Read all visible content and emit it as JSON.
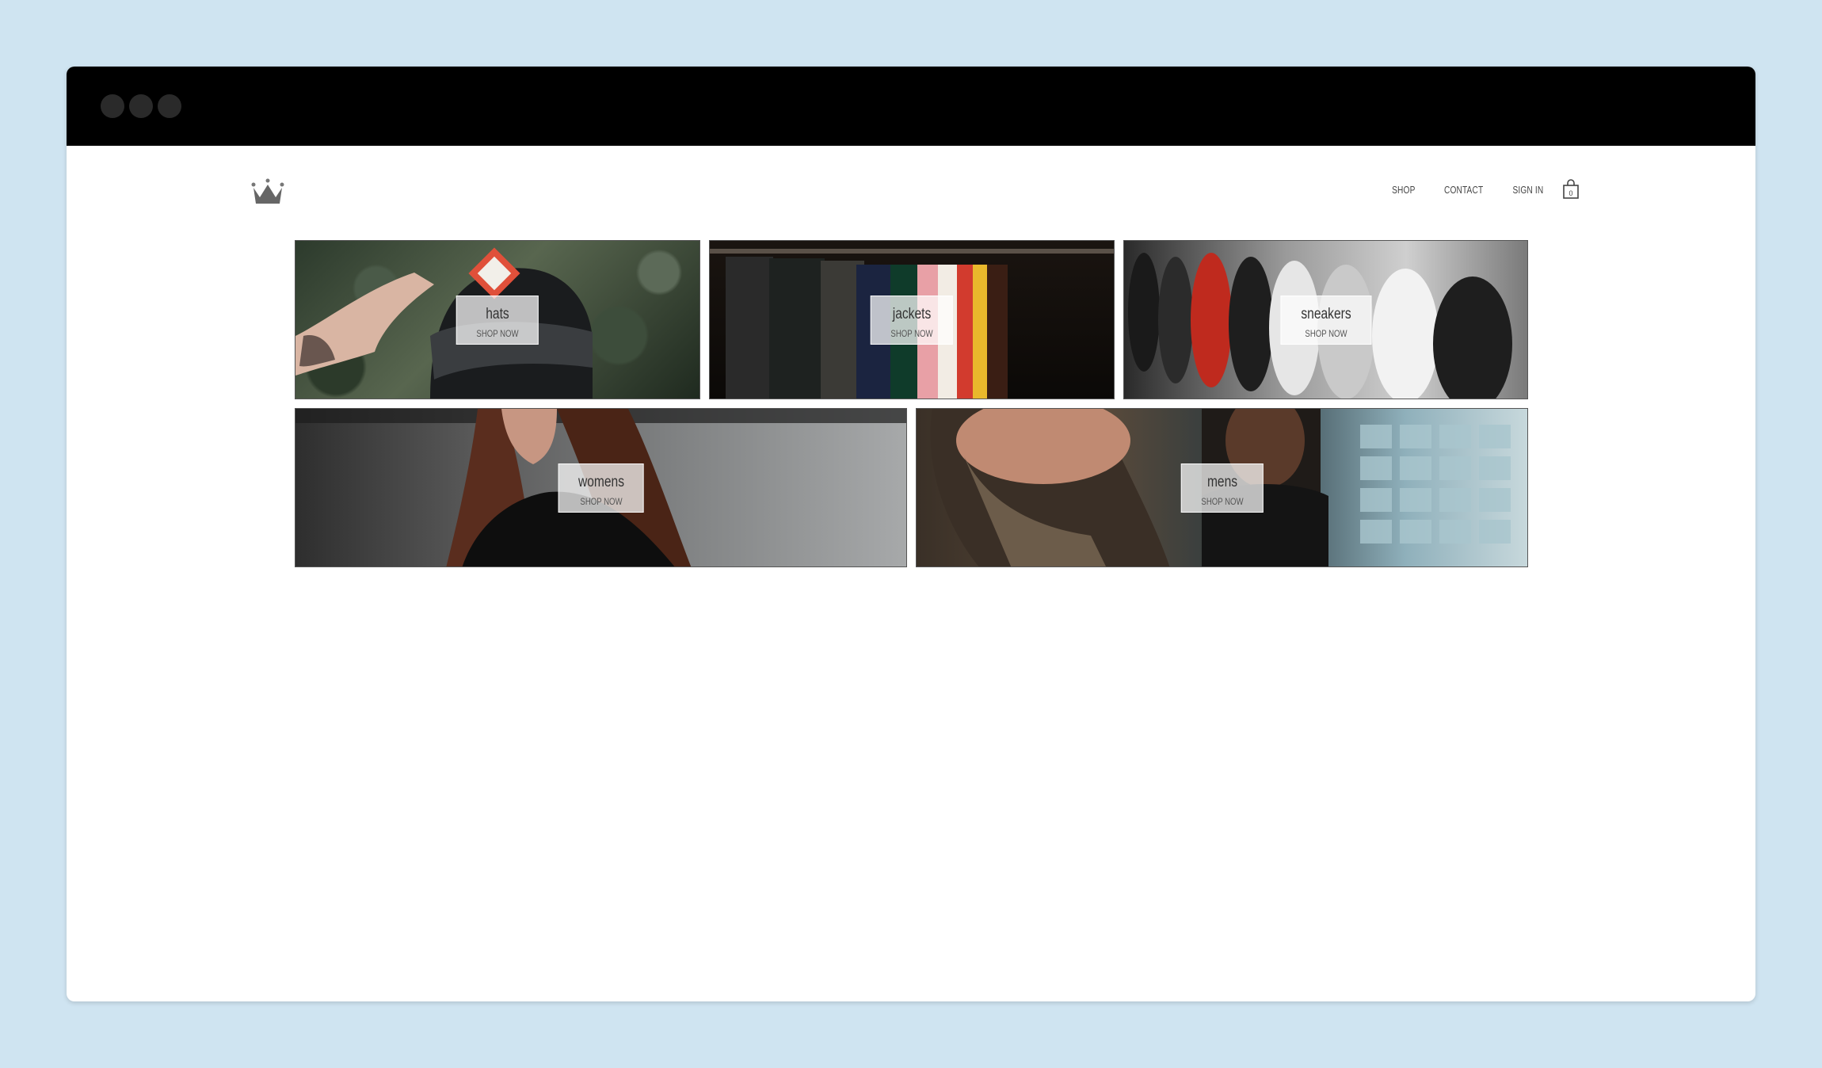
{
  "window": {
    "title_bar_color": "#000000"
  },
  "header": {
    "logo_icon": "crown-icon",
    "nav": [
      {
        "label": "SHOP"
      },
      {
        "label": "CONTACT"
      },
      {
        "label": "SIGN IN"
      }
    ],
    "cart_icon": "shopping-bag-icon",
    "cart_count": "0"
  },
  "categories": [
    {
      "title": "hats",
      "cta": "SHOP NOW"
    },
    {
      "title": "jackets",
      "cta": "SHOP NOW"
    },
    {
      "title": "sneakers",
      "cta": "SHOP NOW"
    },
    {
      "title": "womens",
      "cta": "SHOP NOW"
    },
    {
      "title": "mens",
      "cta": "SHOP NOW"
    }
  ]
}
